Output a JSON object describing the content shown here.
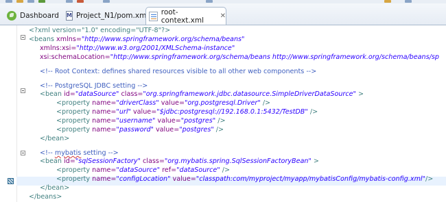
{
  "tabs": [
    {
      "label": "Dashboard",
      "icon": "spring-dashboard-icon",
      "active": false
    },
    {
      "label": "Project_N1/pom.xml",
      "icon": "maven-pom-icon",
      "active": false
    },
    {
      "label": "root-context.xml",
      "icon": "xml-file-icon",
      "active": true,
      "close": "✕"
    }
  ],
  "code": {
    "l1_pi": "<?xml version=\"1.0\" encoding=\"UTF-8\"?>",
    "l2_open": "<beans",
    "l2_attr": " xmlns=",
    "l2_val": "\"http://www.springframework.org/schema/beans\"",
    "l3_attr": "xmlns:xsi=",
    "l3_val": "\"http://www.w3.org/2001/XMLSchema-instance\"",
    "l4_attr": "xsi:schemaLocation=",
    "l4_val": "\"http://www.springframework.org/schema/beans http://www.springframework.org/schema/beans/sp",
    "c_root": "<!-- Root Context: defines shared resources visible to all other web components -->",
    "c_pg": "<!-- PostgreSQL JDBC setting -->",
    "b1_tag": "<bean",
    "b1_id_attr": " id=",
    "b1_id_val": "\"dataSource\"",
    "b1_class_attr": " class=",
    "b1_class_val": "\"org.springframework.jdbc.datasource.SimpleDriverDataSource\"",
    "b1_end": " >",
    "p1_tag": "<property",
    "p1_name_attr": " name=",
    "p1_name_val": "\"driverClass\"",
    "p1_value_attr": " value=",
    "p1_value_val": "\"org.postgresql.Driver\"",
    "p1_end": " />",
    "p2_name_val": "\"url\"",
    "p2_value_val": "\"$jdbc:postgresql://192.168.0.1:5432/TestDB\"",
    "p3_name_val": "\"username\"",
    "p3_value_val": "\"postgres\"",
    "p4_name_val": "\"password\"",
    "p4_value_val": "\"postgres\"",
    "bean_close": "</bean>",
    "c_mb_open": "<!-- ",
    "c_mb_word": "mybatis",
    "c_mb_rest": " setting -->",
    "b2_id_val": "\"sqlSessionFactory\"",
    "b2_class_val": "\"org.mybatis.spring.SqlSessionFactoryBean\"",
    "p5_name_val": "\"dataSource\"",
    "p5_ref_attr": " ref=",
    "p5_ref_val": "\"dataSource\"",
    "p6_name_val": "\"configLocation\"",
    "p6_value_val": "\"classpath:com/myproject/myapp/mybatisConfig/mybatis-config.xml\"",
    "p6_end": "/>",
    "beans_close": "</beans>"
  },
  "colors": {
    "tag": "#3f7f7f",
    "attribute": "#7f007f",
    "value": "#2a00ff",
    "comment": "#3f5fbf",
    "current_line": "#e8f2fe"
  }
}
